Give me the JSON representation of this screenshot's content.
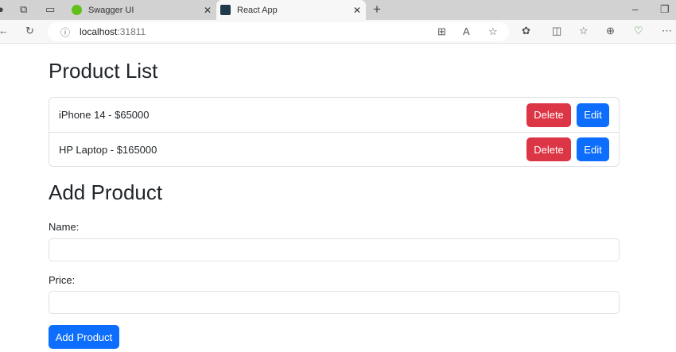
{
  "browser": {
    "tabs": [
      {
        "title": "Swagger UI",
        "active": false
      },
      {
        "title": "React App",
        "active": true
      }
    ],
    "url_host": "localhost",
    "url_port": ":31811"
  },
  "page": {
    "list_title": "Product List",
    "products": [
      {
        "label": "iPhone 14 - $65000"
      },
      {
        "label": "HP Laptop - $165000"
      }
    ],
    "delete_label": "Delete",
    "edit_label": "Edit",
    "form_title": "Add Product",
    "name_label": "Name:",
    "name_value": "",
    "price_label": "Price:",
    "price_value": "",
    "submit_label": "Add Product"
  }
}
